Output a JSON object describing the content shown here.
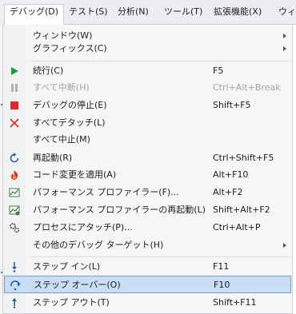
{
  "menubar": {
    "items": [
      {
        "label": "デバッグ(D)",
        "active": true
      },
      {
        "label": "テスト(S)"
      },
      {
        "label": "分析(N)"
      },
      {
        "label": "ツール(T)"
      },
      {
        "label": "拡張機能(X)"
      },
      {
        "label": "ウィン"
      }
    ]
  },
  "menu": {
    "items": [
      {
        "label": "ウィンドウ(W)",
        "submenu": true
      },
      {
        "label": "グラフィックス(C)",
        "submenu": true
      },
      {
        "label": "続行(C)",
        "shortcut": "F5",
        "icon": "play-icon"
      },
      {
        "label": "すべて中断(H)",
        "shortcut": "Ctrl+Alt+Break",
        "icon": "pause-icon",
        "disabled": true
      },
      {
        "label": "デバッグの停止(E)",
        "shortcut": "Shift+F5",
        "icon": "stop-icon"
      },
      {
        "label": "すべてデタッチ(L)",
        "icon": "detach-icon"
      },
      {
        "label": "すべて中止(M)"
      },
      {
        "label": "再起動(R)",
        "shortcut": "Ctrl+Shift+F5",
        "icon": "restart-icon"
      },
      {
        "label": "コード変更を適用(A)",
        "shortcut": "Alt+F10",
        "icon": "hot-reload-icon"
      },
      {
        "label": "パフォーマンス プロファイラー(F)...",
        "shortcut": "Alt+F2",
        "icon": "profiler-icon"
      },
      {
        "label": "パフォーマンス プロファイラーの再起動(L)",
        "shortcut": "Shift+Alt+F2",
        "icon": "profiler-restart-icon"
      },
      {
        "label": "プロセスにアタッチ(P)...",
        "shortcut": "Ctrl+Alt+P",
        "icon": "attach-process-icon"
      },
      {
        "label": "その他のデバッグ ターゲット(H)",
        "submenu": true
      },
      {
        "label": "ステップ イン(L)",
        "shortcut": "F11",
        "icon": "step-into-icon"
      },
      {
        "label": "ステップ オーバー(O)",
        "shortcut": "F10",
        "icon": "step-over-icon",
        "highlighted": true
      },
      {
        "label": "ステップ アウト(T)",
        "shortcut": "Shift+F11",
        "icon": "step-out-icon"
      }
    ]
  },
  "colors": {
    "highlight": "#c9def5",
    "highlight_border": "#6d9fd6",
    "play": "#1e9b3e",
    "stop": "#e5262c",
    "icon_blue": "#1f5fb0"
  }
}
